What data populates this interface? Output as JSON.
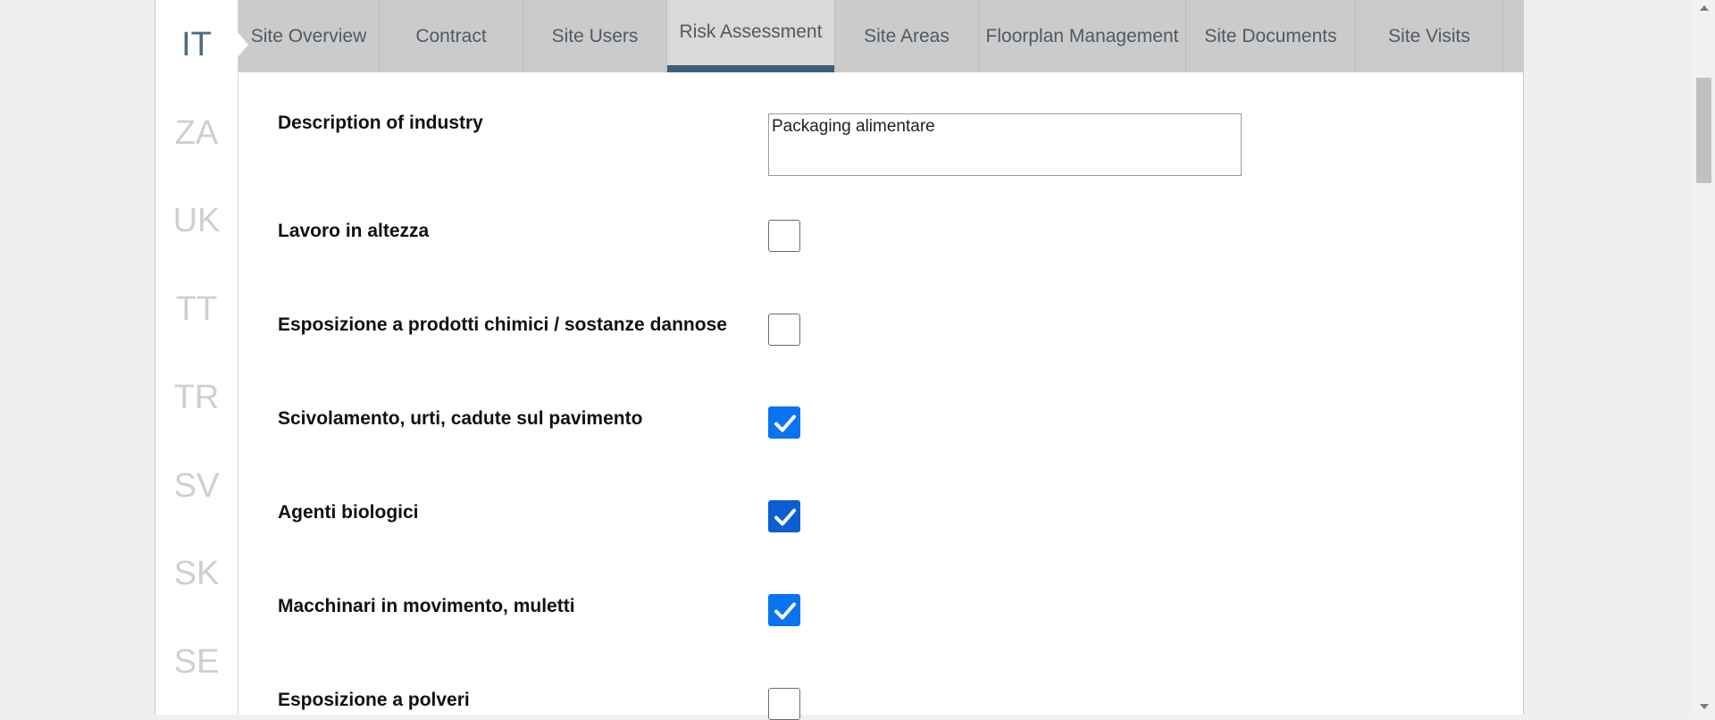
{
  "languages": [
    {
      "code": "IT",
      "active": true
    },
    {
      "code": "ZA",
      "active": false
    },
    {
      "code": "UK",
      "active": false
    },
    {
      "code": "TT",
      "active": false
    },
    {
      "code": "TR",
      "active": false
    },
    {
      "code": "SV",
      "active": false
    },
    {
      "code": "SK",
      "active": false
    },
    {
      "code": "SE",
      "active": false
    }
  ],
  "tabs": [
    {
      "label": "Site Overview",
      "active": false
    },
    {
      "label": "Contract",
      "active": false
    },
    {
      "label": "Site Users",
      "active": false
    },
    {
      "label": "Risk Assessment",
      "active": true
    },
    {
      "label": "Site Areas",
      "active": false
    },
    {
      "label": "Floorplan Management",
      "active": false
    },
    {
      "label": "Site Documents",
      "active": false
    },
    {
      "label": "Site Visits",
      "active": false
    }
  ],
  "form": {
    "industry": {
      "label": "Description of industry",
      "value": "Packaging alimentare"
    },
    "risks": [
      {
        "label": "Lavoro in altezza",
        "checked": false
      },
      {
        "label": "Esposizione a prodotti chimici / sostanze dannose",
        "checked": false
      },
      {
        "label": "Scivolamento, urti, cadute sul pavimento",
        "checked": true
      },
      {
        "label": "Agenti biologici",
        "checked": true
      },
      {
        "label": "Macchinari in movimento, muletti",
        "checked": true
      },
      {
        "label": "Esposizione a polveri",
        "checked": false
      }
    ]
  },
  "colors": {
    "accent": "#3f5f78",
    "checkbox_checked": "#0a74f0",
    "active_language": "#4e6b80",
    "inactive_language": "#cfcfcf"
  }
}
